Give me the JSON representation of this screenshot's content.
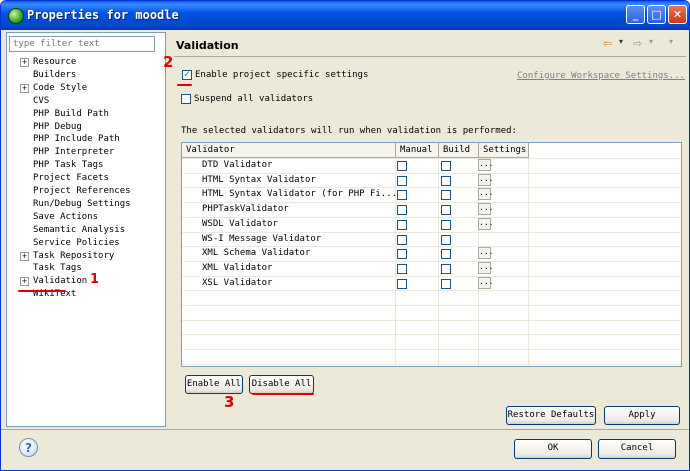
{
  "window": {
    "title": "Properties for moodle"
  },
  "filter": {
    "placeholder": "type filter text"
  },
  "tree": [
    {
      "label": "Resource",
      "expandable": true
    },
    {
      "label": "Builders",
      "expandable": false
    },
    {
      "label": "Code Style",
      "expandable": true
    },
    {
      "label": "CVS",
      "expandable": false
    },
    {
      "label": "PHP Build Path",
      "expandable": false
    },
    {
      "label": "PHP Debug",
      "expandable": false
    },
    {
      "label": "PHP Include Path",
      "expandable": false
    },
    {
      "label": "PHP Interpreter",
      "expandable": false
    },
    {
      "label": "PHP Task Tags",
      "expandable": false
    },
    {
      "label": "Project Facets",
      "expandable": false
    },
    {
      "label": "Project References",
      "expandable": false
    },
    {
      "label": "Run/Debug Settings",
      "expandable": false
    },
    {
      "label": "Save Actions",
      "expandable": false
    },
    {
      "label": "Semantic Analysis",
      "expandable": false
    },
    {
      "label": "Service Policies",
      "expandable": false
    },
    {
      "label": "Task Repository",
      "expandable": true
    },
    {
      "label": "Task Tags",
      "expandable": false
    },
    {
      "label": "Validation",
      "expandable": true,
      "selected": true
    },
    {
      "label": "WikiText",
      "expandable": false
    }
  ],
  "page": {
    "title": "Validation",
    "enable_project_settings": "Enable project specific settings",
    "enable_project_settings_checked": true,
    "configure_workspace_link": "Configure Workspace Settings...",
    "suspend_all": "Suspend all validators",
    "suspend_all_checked": false,
    "info_text": "The selected validators will run when validation is performed:"
  },
  "table": {
    "headers": [
      "Validator",
      "Manual",
      "Build",
      "Settings"
    ],
    "rows": [
      {
        "name": "DTD Validator",
        "has_settings": true
      },
      {
        "name": "HTML Syntax Validator",
        "has_settings": true
      },
      {
        "name": "HTML Syntax Validator (for PHP Fi...",
        "has_settings": true
      },
      {
        "name": "PHPTaskValidator",
        "has_settings": true
      },
      {
        "name": "WSDL Validator",
        "has_settings": true
      },
      {
        "name": "WS-I Message Validator",
        "has_settings": false
      },
      {
        "name": "XML Schema Validator",
        "has_settings": true
      },
      {
        "name": "XML Validator",
        "has_settings": true
      },
      {
        "name": "XSL Validator",
        "has_settings": true
      }
    ],
    "settings_glyph": "..."
  },
  "buttons": {
    "enable_all": "Enable All",
    "disable_all": "Disable All",
    "restore_defaults": "Restore Defaults",
    "apply": "Apply",
    "ok": "OK",
    "cancel": "Cancel"
  },
  "annotations": {
    "one": "1",
    "two": "2",
    "three": "3"
  },
  "colors": {
    "annotation": "#e10000",
    "titlebar": "#0054e3"
  }
}
